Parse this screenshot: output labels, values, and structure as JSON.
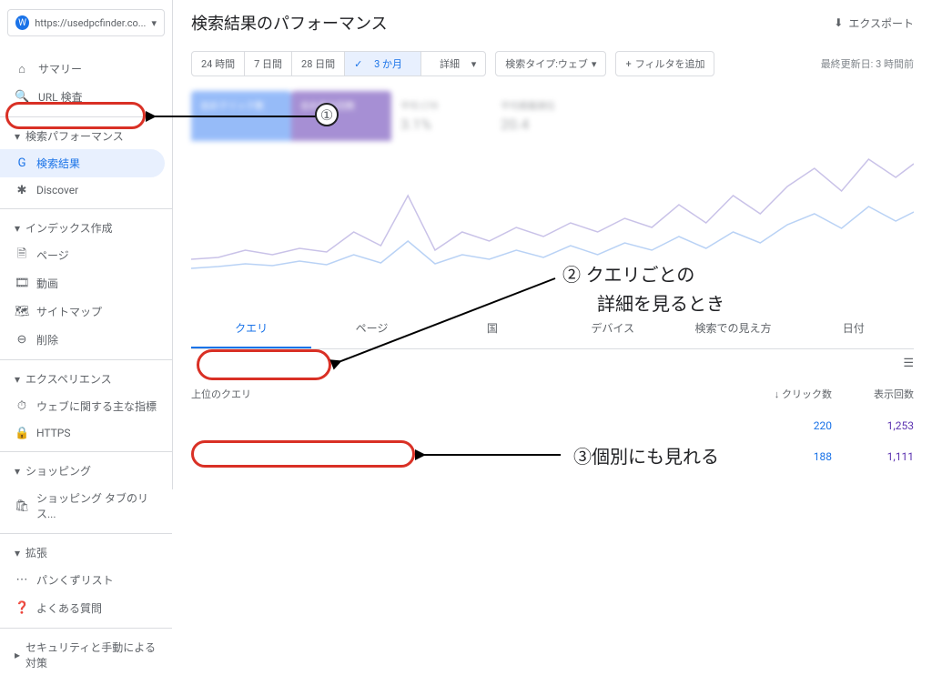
{
  "site_url": "https://usedpcfinder.co...",
  "page_title": "検索結果のパフォーマンス",
  "export_label": "エクスポート",
  "last_update": "最終更新日: 3 時間前",
  "date_ranges": {
    "r1": "24 時間",
    "r2": "7 日間",
    "r3": "28 日間",
    "r4": "3 か月",
    "r5": "詳細"
  },
  "filters": {
    "type": "検索タイプ:ウェブ",
    "add": "フィルタを追加"
  },
  "metrics": {
    "clicks_label": "合計クリック数",
    "clicks_value": "",
    "impr_label": "合計表示回数",
    "impr_value": "",
    "ctr_label": "平均 CTR",
    "ctr_value": "3.1%",
    "pos_label": "平均掲載順位",
    "pos_value": "20.4"
  },
  "sidebar": {
    "summary": "サマリー",
    "url_inspect": "URL 検査",
    "perf_head": "検索パフォーマンス",
    "perf_results": "検索結果",
    "perf_discover": "Discover",
    "index_head": "インデックス作成",
    "index_pages": "ページ",
    "index_video": "動画",
    "index_sitemaps": "サイトマップ",
    "index_removals": "削除",
    "exp_head": "エクスペリエンス",
    "exp_cwv": "ウェブに関する主な指標",
    "exp_https": "HTTPS",
    "shop_head": "ショッピング",
    "shop_listings": "ショッピング タブのリス...",
    "enh_head": "拡張",
    "enh_breadcrumbs": "パンくずリスト",
    "enh_faq": "よくある質問",
    "security_head": "セキュリティと手動による対策"
  },
  "tabs": {
    "query": "クエリ",
    "page": "ページ",
    "country": "国",
    "device": "デバイス",
    "appearance": "検索での見え方",
    "date": "日付"
  },
  "table": {
    "head_query": "上位のクエリ",
    "head_clicks": "クリック数",
    "head_impr": "表示回数",
    "rows": [
      {
        "clicks": "220",
        "impr": "1,253"
      },
      {
        "clicks": "188",
        "impr": "1,111"
      }
    ]
  },
  "annotations": {
    "n1": "①",
    "n2": "②",
    "n3": "③",
    "t2a": "クエリごとの",
    "t2b": "詳細を見るとき",
    "t3": "個別にも見れる"
  }
}
